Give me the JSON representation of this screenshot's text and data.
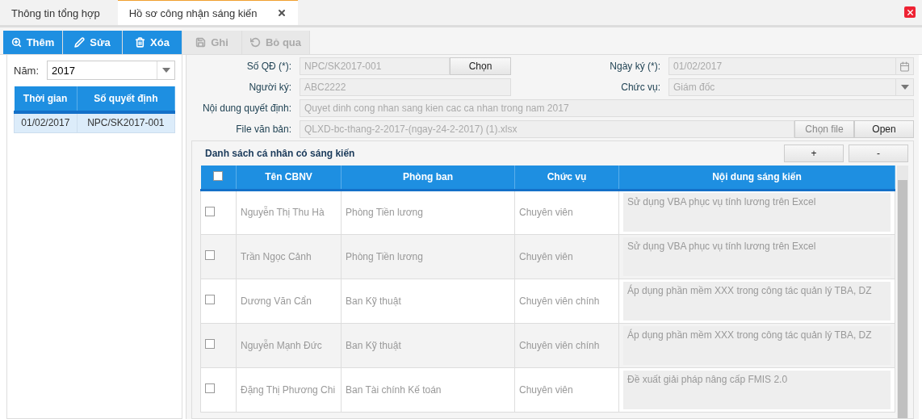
{
  "tabs": [
    {
      "label": "Thông tin tổng hợp",
      "selected": false,
      "closable": false
    },
    {
      "label": "Hồ sơ công nhận sáng kiến",
      "selected": true,
      "closable": true
    }
  ],
  "toolbar": [
    {
      "label": "Thêm",
      "disabled": false
    },
    {
      "label": "Sửa",
      "disabled": false
    },
    {
      "label": "Xóa",
      "disabled": false
    },
    {
      "label": "Ghi",
      "disabled": true
    },
    {
      "label": "Bỏ qua",
      "disabled": true
    }
  ],
  "left": {
    "year_label": "Năm:",
    "year_value": "2017",
    "columns": [
      "Thời gian",
      "Số quyết định"
    ],
    "rows": [
      {
        "cells": [
          "01/02/2017",
          "NPC/SK2017-001"
        ],
        "selected": true
      }
    ]
  },
  "form": {
    "so_qd": {
      "label": "Số QĐ (*):",
      "value": "NPC/SK2017-001",
      "button": "Chọn"
    },
    "ngay_ky": {
      "label": "Ngày ký (*):",
      "value": "01/02/2017"
    },
    "nguoi_ky": {
      "label": "Người ký:",
      "value": "ABC2222"
    },
    "chuc_vu": {
      "label": "Chức vụ:",
      "value": "Giám đốc"
    },
    "noi_dung": {
      "label": "Nội dung quyết định:",
      "value": "Quyet dinh cong nhan sang kien cac ca nhan trong nam 2017"
    },
    "file": {
      "label": "File văn bản:",
      "value": "QLXD-bc-thang-2-2017-(ngay-24-2-2017) (1).xlsx",
      "choose": "Chọn file",
      "open": "Open"
    }
  },
  "list": {
    "title": "Danh sách cá nhân có sáng kiến",
    "add": "+",
    "remove": "-",
    "all_checked": false,
    "columns": [
      "Tên CBNV",
      "Phòng ban",
      "Chức vụ",
      "Nội dung sáng kiến"
    ],
    "rows": [
      {
        "checked": false,
        "name": "Nguyễn Thị Thu Hà",
        "dept": "Phòng Tiền lương",
        "position": "Chuyên viên",
        "content": "Sử dụng VBA phục vụ tính lương trên Excel"
      },
      {
        "checked": false,
        "name": "Trần Ngọc Cảnh",
        "dept": "Phòng Tiền lương",
        "position": "Chuyên viên",
        "content": "Sử dụng VBA phục vụ tính lương trên Excel"
      },
      {
        "checked": false,
        "name": "Dương Văn Cẩn",
        "dept": "Ban Kỹ thuật",
        "position": "Chuyên viên chính",
        "content": "Áp dụng phần mềm XXX trong công tác quản lý TBA, DZ"
      },
      {
        "checked": false,
        "name": "Nguyễn Mạnh Đức",
        "dept": "Ban Kỹ thuật",
        "position": "Chuyên viên chính",
        "content": "Áp dụng phần mềm XXX trong công tác quản lý TBA, DZ"
      },
      {
        "checked": false,
        "name": "Đặng Thị Phương Chi",
        "dept": "Ban Tài chính Kế toán",
        "position": "Chuyên viên",
        "content": "Đề xuất giải pháp nâng cấp FMIS 2.0"
      }
    ]
  }
}
